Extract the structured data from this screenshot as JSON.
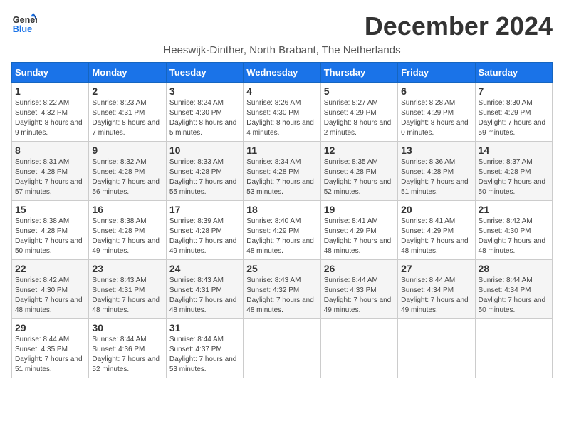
{
  "logo": {
    "line1": "General",
    "line2": "Blue"
  },
  "title": "December 2024",
  "subtitle": "Heeswijk-Dinther, North Brabant, The Netherlands",
  "weekdays": [
    "Sunday",
    "Monday",
    "Tuesday",
    "Wednesday",
    "Thursday",
    "Friday",
    "Saturday"
  ],
  "weeks": [
    [
      {
        "day": "1",
        "info": "Sunrise: 8:22 AM\nSunset: 4:32 PM\nDaylight: 8 hours and 9 minutes."
      },
      {
        "day": "2",
        "info": "Sunrise: 8:23 AM\nSunset: 4:31 PM\nDaylight: 8 hours and 7 minutes."
      },
      {
        "day": "3",
        "info": "Sunrise: 8:24 AM\nSunset: 4:30 PM\nDaylight: 8 hours and 5 minutes."
      },
      {
        "day": "4",
        "info": "Sunrise: 8:26 AM\nSunset: 4:30 PM\nDaylight: 8 hours and 4 minutes."
      },
      {
        "day": "5",
        "info": "Sunrise: 8:27 AM\nSunset: 4:29 PM\nDaylight: 8 hours and 2 minutes."
      },
      {
        "day": "6",
        "info": "Sunrise: 8:28 AM\nSunset: 4:29 PM\nDaylight: 8 hours and 0 minutes."
      },
      {
        "day": "7",
        "info": "Sunrise: 8:30 AM\nSunset: 4:29 PM\nDaylight: 7 hours and 59 minutes."
      }
    ],
    [
      {
        "day": "8",
        "info": "Sunrise: 8:31 AM\nSunset: 4:28 PM\nDaylight: 7 hours and 57 minutes."
      },
      {
        "day": "9",
        "info": "Sunrise: 8:32 AM\nSunset: 4:28 PM\nDaylight: 7 hours and 56 minutes."
      },
      {
        "day": "10",
        "info": "Sunrise: 8:33 AM\nSunset: 4:28 PM\nDaylight: 7 hours and 55 minutes."
      },
      {
        "day": "11",
        "info": "Sunrise: 8:34 AM\nSunset: 4:28 PM\nDaylight: 7 hours and 53 minutes."
      },
      {
        "day": "12",
        "info": "Sunrise: 8:35 AM\nSunset: 4:28 PM\nDaylight: 7 hours and 52 minutes."
      },
      {
        "day": "13",
        "info": "Sunrise: 8:36 AM\nSunset: 4:28 PM\nDaylight: 7 hours and 51 minutes."
      },
      {
        "day": "14",
        "info": "Sunrise: 8:37 AM\nSunset: 4:28 PM\nDaylight: 7 hours and 50 minutes."
      }
    ],
    [
      {
        "day": "15",
        "info": "Sunrise: 8:38 AM\nSunset: 4:28 PM\nDaylight: 7 hours and 50 minutes."
      },
      {
        "day": "16",
        "info": "Sunrise: 8:38 AM\nSunset: 4:28 PM\nDaylight: 7 hours and 49 minutes."
      },
      {
        "day": "17",
        "info": "Sunrise: 8:39 AM\nSunset: 4:28 PM\nDaylight: 7 hours and 49 minutes."
      },
      {
        "day": "18",
        "info": "Sunrise: 8:40 AM\nSunset: 4:29 PM\nDaylight: 7 hours and 48 minutes."
      },
      {
        "day": "19",
        "info": "Sunrise: 8:41 AM\nSunset: 4:29 PM\nDaylight: 7 hours and 48 minutes."
      },
      {
        "day": "20",
        "info": "Sunrise: 8:41 AM\nSunset: 4:29 PM\nDaylight: 7 hours and 48 minutes."
      },
      {
        "day": "21",
        "info": "Sunrise: 8:42 AM\nSunset: 4:30 PM\nDaylight: 7 hours and 48 minutes."
      }
    ],
    [
      {
        "day": "22",
        "info": "Sunrise: 8:42 AM\nSunset: 4:30 PM\nDaylight: 7 hours and 48 minutes."
      },
      {
        "day": "23",
        "info": "Sunrise: 8:43 AM\nSunset: 4:31 PM\nDaylight: 7 hours and 48 minutes."
      },
      {
        "day": "24",
        "info": "Sunrise: 8:43 AM\nSunset: 4:31 PM\nDaylight: 7 hours and 48 minutes."
      },
      {
        "day": "25",
        "info": "Sunrise: 8:43 AM\nSunset: 4:32 PM\nDaylight: 7 hours and 48 minutes."
      },
      {
        "day": "26",
        "info": "Sunrise: 8:44 AM\nSunset: 4:33 PM\nDaylight: 7 hours and 49 minutes."
      },
      {
        "day": "27",
        "info": "Sunrise: 8:44 AM\nSunset: 4:34 PM\nDaylight: 7 hours and 49 minutes."
      },
      {
        "day": "28",
        "info": "Sunrise: 8:44 AM\nSunset: 4:34 PM\nDaylight: 7 hours and 50 minutes."
      }
    ],
    [
      {
        "day": "29",
        "info": "Sunrise: 8:44 AM\nSunset: 4:35 PM\nDaylight: 7 hours and 51 minutes."
      },
      {
        "day": "30",
        "info": "Sunrise: 8:44 AM\nSunset: 4:36 PM\nDaylight: 7 hours and 52 minutes."
      },
      {
        "day": "31",
        "info": "Sunrise: 8:44 AM\nSunset: 4:37 PM\nDaylight: 7 hours and 53 minutes."
      },
      null,
      null,
      null,
      null
    ]
  ]
}
